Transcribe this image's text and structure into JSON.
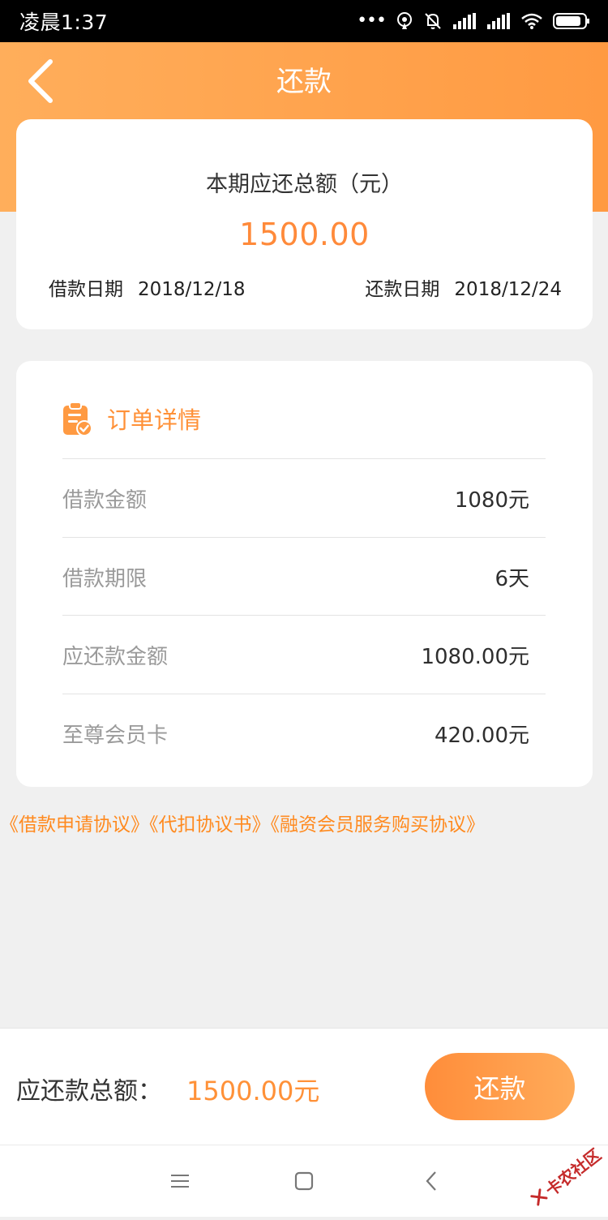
{
  "status_bar": {
    "time": "凌晨1:37",
    "dots": "•••"
  },
  "header": {
    "title": "还款"
  },
  "summary": {
    "label": "本期应还总额（元）",
    "amount": "1500.00",
    "borrow_date_label": "借款日期",
    "borrow_date": "2018/12/18",
    "repay_date_label": "还款日期",
    "repay_date": "2018/12/24"
  },
  "details": {
    "title": "订单详情",
    "rows": [
      {
        "label": "借款金额",
        "value": "1080元"
      },
      {
        "label": "借款期限",
        "value": "6天"
      },
      {
        "label": "应还款金额",
        "value": "1080.00元"
      },
      {
        "label": "至尊会员卡",
        "value": "420.00元"
      }
    ]
  },
  "agreements": [
    "《借款申请协议》",
    "《代扣协议书》",
    "《融资会员服务购买协议》"
  ],
  "footer": {
    "total_label": "应还款总额：",
    "total_amount": "1500.00元",
    "pay_button": "还款"
  },
  "watermark": {
    "text": "卡农社区"
  },
  "colors": {
    "accent": "#ff9138",
    "header": "#ffa24c",
    "link": "#ff8a1f"
  },
  "icons": [
    "back-arrow-icon",
    "order-clipboard-icon",
    "menu-icon",
    "home-square-icon",
    "back-nav-icon"
  ]
}
